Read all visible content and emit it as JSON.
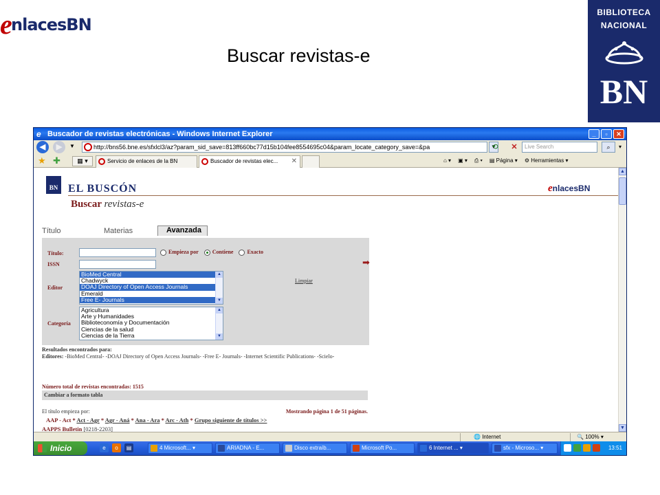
{
  "slide": {
    "logo_e": "e",
    "logo_text": "nlacesBN",
    "title": "Buscar revistas-e",
    "bn_logo": {
      "line1": "BIBLIOTECA",
      "line2": "NACIONAL",
      "big": "BN"
    }
  },
  "browser": {
    "window_title": "Buscador de revistas electrónicas - Windows Internet Explorer",
    "url": "http://bns56.bne.es/sfxlcl3/az?param_sid_save=813ff660bc77d15b104fee8554695c04&param_locate_category_save=&pa",
    "search_placeholder": "Live Search",
    "tabs": [
      {
        "label": "Servicio de enlaces de la BN"
      },
      {
        "label": "Buscador de revistas elec..."
      }
    ],
    "commands": {
      "page": "Página",
      "tools": "Herramientas"
    },
    "status": {
      "zone": "Internet",
      "zoom": "100%"
    }
  },
  "page": {
    "header": {
      "bn": "BN",
      "buscon": "EL BUSCÓN",
      "buscar": "Buscar",
      "revistas": "revistas-e",
      "enlaces_e": "e",
      "enlaces_text": "nlacesBN"
    },
    "content_tabs": [
      "Título",
      "Materias",
      "Avanzada"
    ],
    "form": {
      "titulo_label": "Título:",
      "issn_label": "ISSN",
      "editor_label": "Editor",
      "categoria_label": "Categoría",
      "radio_options": [
        "Empieza por",
        "Contiene",
        "Exacto"
      ],
      "radio_selected": "Contiene",
      "limpiar": "Limpiar",
      "editor_options": [
        {
          "label": "BioMed Central",
          "selected": true
        },
        {
          "label": "Chadwyck",
          "selected": false
        },
        {
          "label": "DOAJ Directory of Open Access Journals",
          "selected": true
        },
        {
          "label": "Emerald",
          "selected": false
        },
        {
          "label": "Free E- Journals",
          "selected": true
        }
      ],
      "categoria_options": [
        "Agricultura",
        "Arte y Humanidades",
        "Biblioteconomía y Documentación",
        "Ciencias de la salud",
        "Ciencias de la Tierra"
      ]
    },
    "results": {
      "heading": "Resultados encontrados para:",
      "editores_label": "Editores:",
      "editores_list": "-BioMed Central- -DOAJ Directory of Open Access Journals- -Free E- Journals- -Internet Scientific Publications- -Scielo-",
      "total": "Número total de revistas encontradas: 1515",
      "formato": "Cambiar a formato tabla",
      "starts_with": "El título empieza por:",
      "paging": "Mostrando página 1 de 51 páginas.",
      "alpha_nav": [
        "AAP - Act",
        "Act - Agr",
        "Agr - Aná",
        "Ana - Ara",
        "Arc - Ath",
        "Grupo siguiente de títulos >>"
      ],
      "first_title": "AAPPS Bulletin",
      "first_issn": "[0218-2203]"
    }
  },
  "taskbar": {
    "start": "Inicio",
    "tasks": [
      {
        "label": "4 Microsoft..."
      },
      {
        "label": "ARIADNA - E..."
      },
      {
        "label": "Disco extraíb..."
      },
      {
        "label": "Microsoft Po..."
      },
      {
        "label": "6 Internet ..."
      },
      {
        "label": "sfx - Microso..."
      }
    ],
    "clock": "13:51"
  }
}
